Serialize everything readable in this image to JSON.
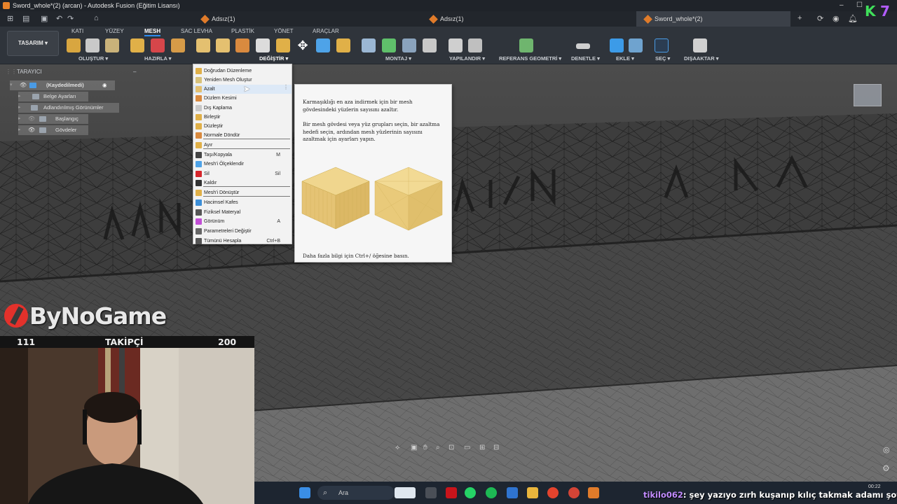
{
  "window": {
    "title": "Sword_whole*(2) (arcan) - Autodesk Fusion (Eğitim Lisansı)"
  },
  "tabs": [
    {
      "label": "Adsız(1)"
    },
    {
      "label": "Adsız(1)"
    },
    {
      "label": "Sword_whole*(2)"
    }
  ],
  "ribbon": {
    "workspace": "TASARIM",
    "tabs": [
      "KATI",
      "YÜZEY",
      "MESH",
      "SAC LEVHA",
      "PLASTİK",
      "YÖNET",
      "ARAÇLAR"
    ],
    "active_tab": "MESH",
    "groups": [
      "OLUŞTUR",
      "HAZIRLA",
      "DEĞİŞTİR",
      "MONTAJ",
      "YAPILANDIR",
      "REFERANS GEOMETRİ",
      "DENETLE",
      "EKLE",
      "SEÇ",
      "DIŞAAKTAR"
    ]
  },
  "browser": {
    "title": "TARAYICI",
    "items": [
      {
        "label": "(Kaydedilmedi)"
      },
      {
        "label": "Belge Ayarları"
      },
      {
        "label": "Adlandırılmış Görünümler"
      },
      {
        "label": "Başlangıç"
      },
      {
        "label": "Gövdeler"
      }
    ]
  },
  "modify_menu": {
    "items": [
      {
        "label": "Doğrudan Düzenleme",
        "shortcut": "",
        "icon": "direct-edit-icon"
      },
      {
        "label": "Yeniden Mesh Oluştur",
        "shortcut": "",
        "icon": "remesh-icon"
      },
      {
        "label": "Azalt",
        "shortcut": "",
        "icon": "reduce-icon"
      },
      {
        "label": "Düzlem Kesimi",
        "shortcut": "",
        "icon": "plane-cut-icon"
      },
      {
        "label": "Dış Kaplama",
        "shortcut": "",
        "icon": "shell-icon"
      },
      {
        "label": "Birleştir",
        "shortcut": "",
        "icon": "combine-icon"
      },
      {
        "label": "Düzleştir",
        "shortcut": "",
        "icon": "smooth-icon"
      },
      {
        "label": "Normale Döndür",
        "shortcut": "",
        "icon": "reverse-normal-icon"
      },
      {
        "label": "Ayır",
        "shortcut": "",
        "icon": "separate-icon"
      },
      {
        "label": "Taşı/Kopyala",
        "shortcut": "M",
        "icon": "move-icon"
      },
      {
        "label": "Mesh'i Ölçeklendir",
        "shortcut": "",
        "icon": "scale-icon"
      },
      {
        "label": "Sil",
        "shortcut": "Sil",
        "icon": "delete-icon"
      },
      {
        "label": "Kaldır",
        "shortcut": "",
        "icon": "remove-icon"
      },
      {
        "label": "Mesh'i Dönüştür",
        "shortcut": "",
        "icon": "convert-icon"
      },
      {
        "label": "Hacimsel Kafes",
        "shortcut": "",
        "icon": "lattice-icon"
      },
      {
        "label": "Fiziksel Materyal",
        "shortcut": "",
        "icon": "material-icon"
      },
      {
        "label": "Görünüm",
        "shortcut": "A",
        "icon": "appearance-icon"
      },
      {
        "label": "Parametreleri Değiştir",
        "shortcut": "",
        "icon": "parameters-icon"
      },
      {
        "label": "Tümünü Hesapla",
        "shortcut": "Ctrl+B",
        "icon": "compute-icon"
      }
    ]
  },
  "tooltip": {
    "line1": "Karmaşıklığı en aza indirmek için bir mesh gövdesindeki yüzlerin sayısını azaltır.",
    "line2": "Bir mesh gövdesi veya yüz grupları seçin, bir azaltma hedefi seçin, ardından mesh yüzlerinin sayısını azaltmak için ayarları yapın.",
    "footer": "Daha fazla bilgi için Ctrl+/ öğesine basın."
  },
  "stream": {
    "brand": "ByNoGame",
    "followers_current": "111",
    "followers_label": "TAKİPÇİ",
    "followers_goal": "200",
    "chat_user": "tikilo062",
    "chat_message": ": şey yazıyo zırh kuşanıp kılıç takmak adamı şovalye yapmaz"
  },
  "taskbar": {
    "search_placeholder": "Ara",
    "time": "00:22"
  },
  "colors": {
    "accent": "#2d8cf0",
    "ribbon_bg": "#2f343b",
    "menu_bg": "#f2f2f2",
    "brand_red": "#e3312b"
  }
}
